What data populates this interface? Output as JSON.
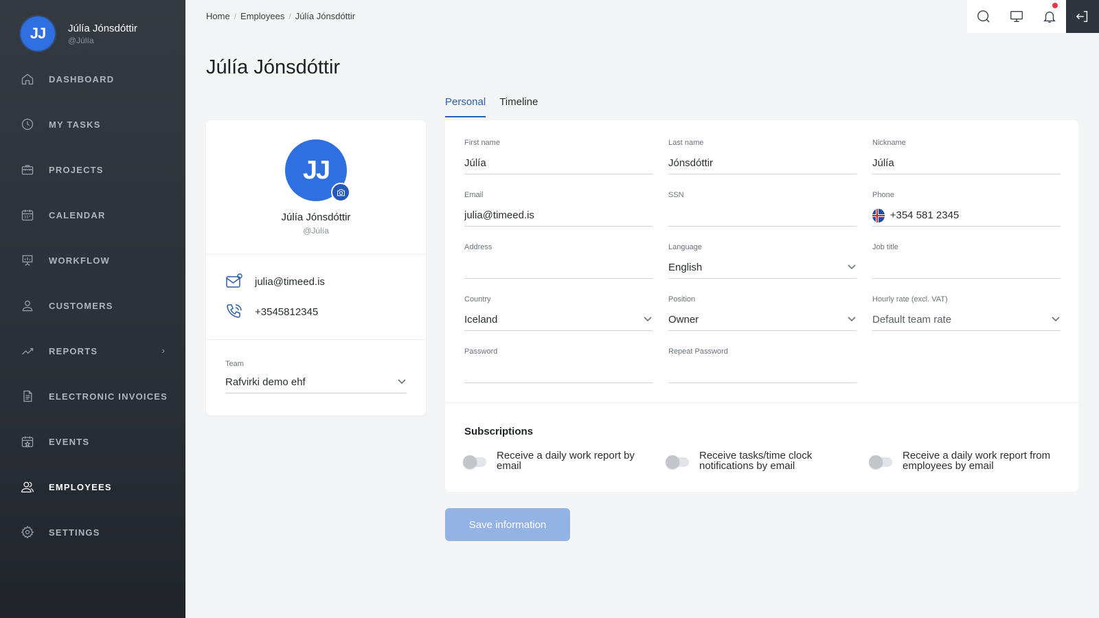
{
  "user": {
    "initials": "JJ",
    "name": "Júlía Jónsdóttir",
    "handle": "@Júlía"
  },
  "nav": [
    {
      "label": "DASHBOARD",
      "icon": "home-icon"
    },
    {
      "label": "MY TASKS",
      "icon": "clock-icon"
    },
    {
      "label": "PROJECTS",
      "icon": "briefcase-icon"
    },
    {
      "label": "CALENDAR",
      "icon": "calendar-icon"
    },
    {
      "label": "WORKFLOW",
      "icon": "presentation-icon"
    },
    {
      "label": "CUSTOMERS",
      "icon": "user-icon"
    },
    {
      "label": "REPORTS",
      "icon": "chart-line-icon"
    },
    {
      "label": "ELECTRONIC INVOICES",
      "icon": "document-icon"
    },
    {
      "label": "EVENTS",
      "icon": "calendar-star-icon"
    },
    {
      "label": "EMPLOYEES",
      "icon": "users-icon",
      "active": true
    },
    {
      "label": "SETTINGS",
      "icon": "gear-icon"
    }
  ],
  "breadcrumb": [
    "Home",
    "Employees",
    "Júlía Jónsdóttir"
  ],
  "page_title": "Júlía Jónsdóttir",
  "profile": {
    "initials": "JJ",
    "name": "Júlía Jónsdóttir",
    "handle": "@Júlía",
    "email": "julia@timeed.is",
    "phone": "+3545812345",
    "team_label": "Team",
    "team_value": "Rafvirki demo ehf"
  },
  "tabs": [
    "Personal",
    "Timeline"
  ],
  "form": {
    "first_name": {
      "label": "First name",
      "value": "Júlía"
    },
    "last_name": {
      "label": "Last name",
      "value": "Jónsdóttir"
    },
    "nickname": {
      "label": "Nickname",
      "value": "Júlía"
    },
    "email": {
      "label": "Email",
      "value": "julia@timeed.is"
    },
    "ssn": {
      "label": "SSN",
      "value": ""
    },
    "phone": {
      "label": "Phone",
      "value": "+354 581 2345"
    },
    "address": {
      "label": "Address",
      "value": ""
    },
    "language": {
      "label": "Language",
      "value": "English"
    },
    "job_title": {
      "label": "Job title",
      "value": ""
    },
    "country": {
      "label": "Country",
      "value": "Iceland"
    },
    "position": {
      "label": "Position",
      "value": "Owner"
    },
    "hourly_rate": {
      "label": "Hourly rate (excl. VAT)",
      "value": "Default team rate"
    },
    "password": {
      "label": "Password",
      "value": ""
    },
    "repeat_password": {
      "label": "Repeat Password",
      "value": ""
    }
  },
  "subscriptions": {
    "title": "Subscriptions",
    "items": [
      {
        "label": "Receive a daily work report by email",
        "enabled": false
      },
      {
        "label": "Receive tasks/time clock notifications by email",
        "enabled": false
      },
      {
        "label": "Receive a daily work report from employees by email",
        "enabled": false
      }
    ]
  },
  "save_label": "Save information",
  "colors": {
    "accent": "#2c5ea8",
    "avatar": "#2f6fe0",
    "save_button": "#93b3e4",
    "sidebar": "#2b3138"
  }
}
